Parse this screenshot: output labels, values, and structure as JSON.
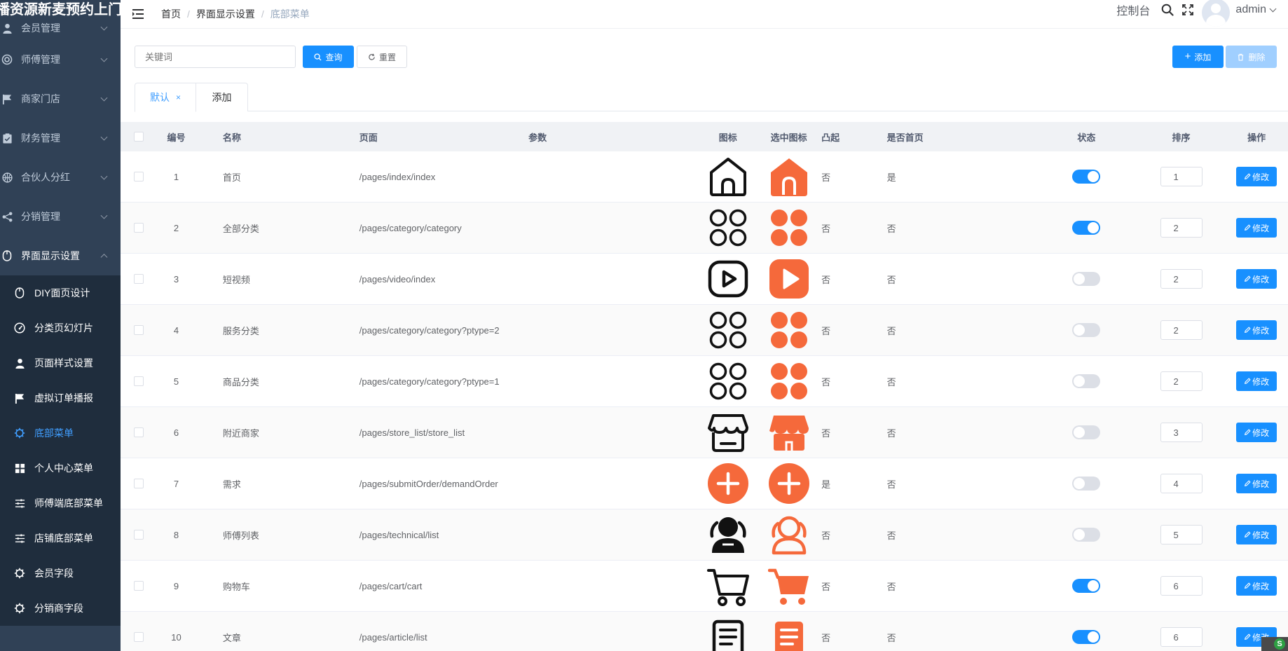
{
  "brand": "播资源新麦预约上门",
  "sidebar": {
    "menus": [
      {
        "label": "会员管理",
        "icon": "user-icon"
      },
      {
        "label": "师傅管理",
        "icon": "shield-icon"
      },
      {
        "label": "商家门店",
        "icon": "flag-icon"
      },
      {
        "label": "财务管理",
        "icon": "clipboard-icon"
      },
      {
        "label": "合伙人分红",
        "icon": "basketball-icon"
      },
      {
        "label": "分销管理",
        "icon": "share-icon"
      },
      {
        "label": "界面显示设置",
        "icon": "mouse-icon"
      }
    ],
    "sub_items": [
      {
        "label": "DIY面页设计",
        "icon": "mouse-icon"
      },
      {
        "label": "分类页幻灯片",
        "icon": "dashboard-icon"
      },
      {
        "label": "页面样式设置",
        "icon": "user-icon"
      },
      {
        "label": "虚拟订单播报",
        "icon": "flag-icon"
      },
      {
        "label": "底部菜单",
        "icon": "cpu-icon"
      },
      {
        "label": "个人中心菜单",
        "icon": "grid-icon"
      },
      {
        "label": "师傅端底部菜单",
        "icon": "sliders-icon"
      },
      {
        "label": "店铺底部菜单",
        "icon": "sliders-icon"
      },
      {
        "label": "会员字段",
        "icon": "cpu-icon"
      },
      {
        "label": "分销商字段",
        "icon": "cpu-icon"
      }
    ]
  },
  "breadcrumb": [
    "首页",
    "界面显示设置",
    "底部菜单"
  ],
  "header": {
    "console": "控制台",
    "user": "admin"
  },
  "search": {
    "placeholder": "关键词",
    "query_label": "查询",
    "reset_label": "重置"
  },
  "actions": {
    "add_label": "添加",
    "delete_label": "删除"
  },
  "tabs": [
    {
      "label": "默认",
      "close": "×"
    },
    {
      "label": "添加"
    }
  ],
  "table": {
    "headers": {
      "id": "编号",
      "name": "名称",
      "page": "页面",
      "param": "参数",
      "icon": "图标",
      "sicon": "选中图标",
      "raised": "凸起",
      "home": "是否首页",
      "status": "状态",
      "sort": "排序",
      "op": "操作"
    },
    "edit_label": "修改",
    "rows": [
      {
        "id": "1",
        "name": "首页",
        "page": "/pages/index/index",
        "icon": "home",
        "raised": "否",
        "home": "是",
        "status": true,
        "sort": "1"
      },
      {
        "id": "2",
        "name": "全部分类",
        "page": "/pages/category/category",
        "icon": "grid",
        "raised": "否",
        "home": "否",
        "status": true,
        "sort": "2"
      },
      {
        "id": "3",
        "name": "短视频",
        "page": "/pages/video/index",
        "icon": "video",
        "raised": "否",
        "home": "否",
        "status": false,
        "sort": "2"
      },
      {
        "id": "4",
        "name": "服务分类",
        "page": "/pages/category/category?ptype=2",
        "icon": "grid",
        "raised": "否",
        "home": "否",
        "status": false,
        "sort": "2"
      },
      {
        "id": "5",
        "name": "商品分类",
        "page": "/pages/category/category?ptype=1",
        "icon": "grid",
        "raised": "否",
        "home": "否",
        "status": false,
        "sort": "2"
      },
      {
        "id": "6",
        "name": "附近商家",
        "page": "/pages/store_list/store_list",
        "icon": "store",
        "raised": "否",
        "home": "否",
        "status": false,
        "sort": "3"
      },
      {
        "id": "7",
        "name": "需求",
        "page": "/pages/submitOrder/demandOrder",
        "icon": "plus",
        "raised": "是",
        "home": "否",
        "status": false,
        "sort": "4"
      },
      {
        "id": "8",
        "name": "师傅列表",
        "page": "/pages/technical/list",
        "icon": "users",
        "raised": "否",
        "home": "否",
        "status": false,
        "sort": "5"
      },
      {
        "id": "9",
        "name": "购物车",
        "page": "/pages/cart/cart",
        "icon": "cart",
        "raised": "否",
        "home": "否",
        "status": true,
        "sort": "6"
      },
      {
        "id": "10",
        "name": "文章",
        "page": "/pages/article/list",
        "icon": "article",
        "raised": "否",
        "home": "否",
        "status": true,
        "sort": "6"
      }
    ]
  },
  "colors": {
    "accent": "#1890ff",
    "sidebar": "#304156",
    "icon_selected": "#f5693b",
    "icon_default": "#111111"
  }
}
